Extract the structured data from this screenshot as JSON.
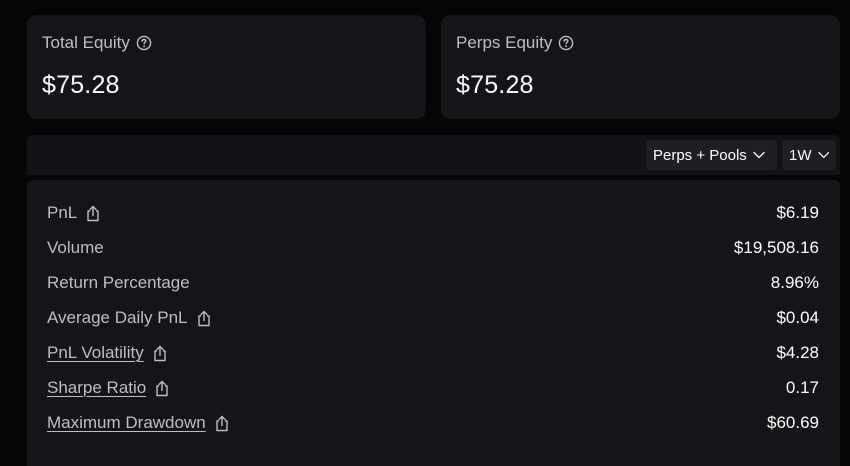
{
  "summary": {
    "total_equity": {
      "label": "Total Equity",
      "value": "$75.28",
      "icon": "help-circle-icon"
    },
    "perps_equity": {
      "label": "Perps Equity",
      "value": "$75.28",
      "icon": "help-circle-icon"
    }
  },
  "filters": {
    "source": {
      "selected": "Perps + Pools",
      "icon": "chevron-down-icon"
    },
    "range": {
      "selected": "1W",
      "icon": "chevron-down-icon"
    }
  },
  "stats": {
    "rows": [
      {
        "label": "PnL",
        "value": "$6.19",
        "share_icon": true,
        "link": false
      },
      {
        "label": "Volume",
        "value": "$19,508.16",
        "share_icon": false,
        "link": false
      },
      {
        "label": "Return Percentage",
        "value": "8.96%",
        "share_icon": false,
        "link": false
      },
      {
        "label": "Average Daily PnL",
        "value": "$0.04",
        "share_icon": true,
        "link": false
      },
      {
        "label": "PnL Volatility",
        "value": "$4.28",
        "share_icon": true,
        "link": true
      },
      {
        "label": "Sharpe Ratio",
        "value": "0.17",
        "share_icon": true,
        "link": true
      },
      {
        "label": "Maximum Drawdown",
        "value": "$60.69",
        "share_icon": true,
        "link": true
      }
    ]
  },
  "colors": {
    "background": "#060609",
    "card": "#151519",
    "toolbar": "#121216",
    "dropdown": "#1e1e23",
    "label": "#bdbdc4",
    "value": "#ffffff"
  }
}
